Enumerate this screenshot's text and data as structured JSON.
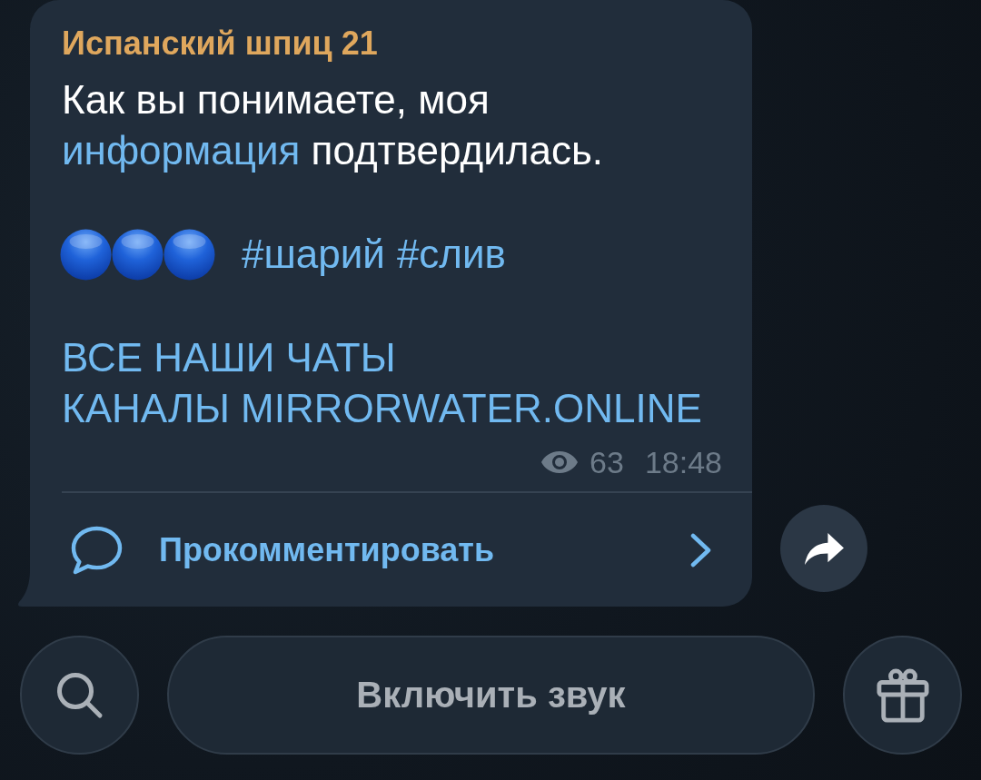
{
  "post": {
    "author": "Испанский шпиц 21",
    "paragraphs": [
      {
        "kind": "text",
        "segments": [
          {
            "kind": "plain",
            "text": "Как вы понимаете, моя "
          },
          {
            "kind": "link",
            "text": "информация"
          },
          {
            "kind": "plain",
            "text": " подтвердилась."
          }
        ]
      },
      {
        "kind": "hashtags",
        "tags": [
          "#шарий",
          "#слив"
        ]
      },
      {
        "kind": "links",
        "links": [
          "ВСЕ НАШИ ЧАТЫ",
          "КАНАЛЫ MIRRORWATER.ONLINE"
        ]
      }
    ],
    "views": "63",
    "time": "18:48",
    "comment_label": "Прокомментировать"
  },
  "bottom_bar": {
    "unmute_label": "Включить звук"
  }
}
